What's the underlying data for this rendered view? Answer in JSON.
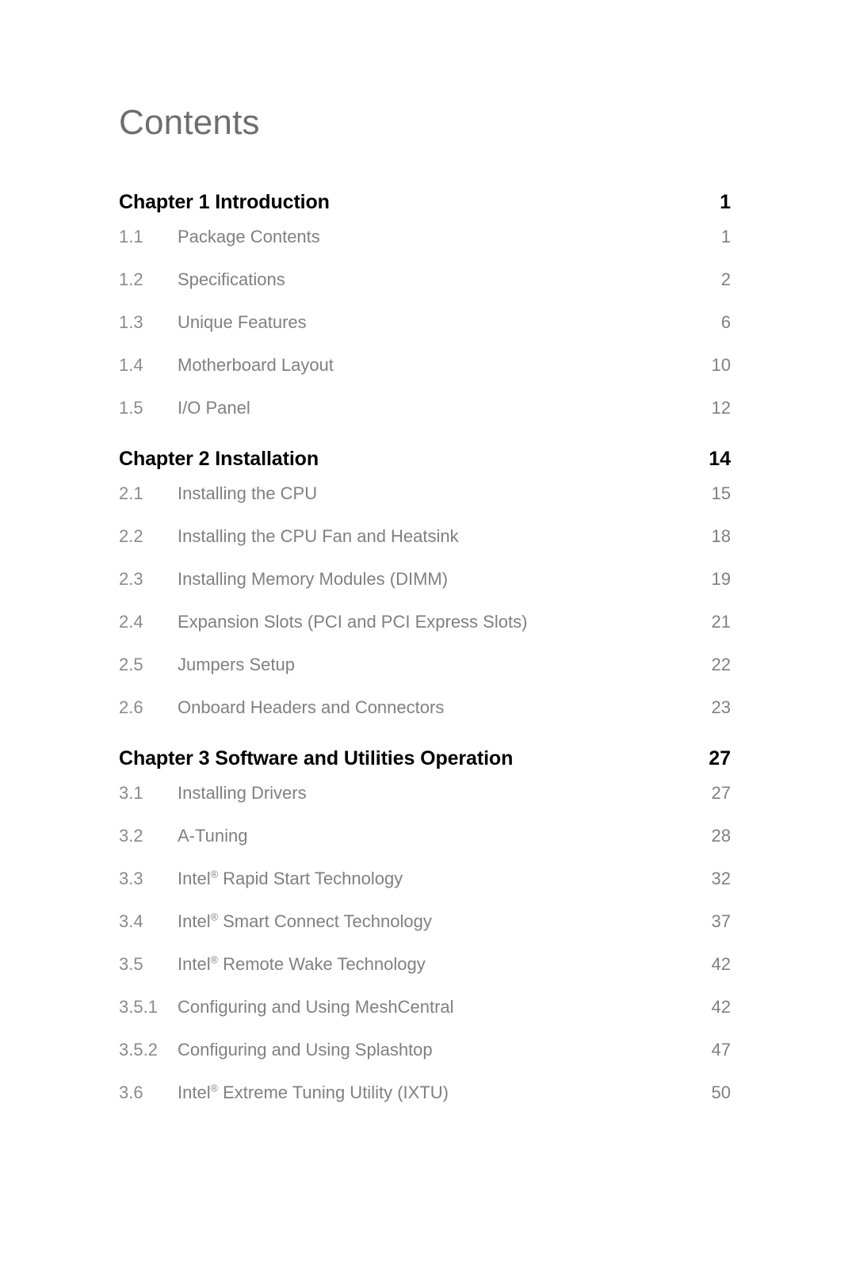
{
  "document": {
    "title": "Contents"
  },
  "colors": {
    "page_background": "#ffffff",
    "title_text": "#6e6e6e",
    "chapter_text": "#000000",
    "section_text": "#808080",
    "section_number_text": "#8a8a8a"
  },
  "toc": {
    "rows": [
      {
        "kind": "chapter",
        "number": "",
        "label": "Chapter  1  Introduction",
        "page": "1"
      },
      {
        "kind": "section",
        "number": "1.1",
        "label": "Package Contents",
        "page": "1"
      },
      {
        "kind": "section",
        "number": "1.2",
        "label": "Specifications",
        "page": "2"
      },
      {
        "kind": "section",
        "number": "1.3",
        "label": "Unique Features",
        "page": "6"
      },
      {
        "kind": "section",
        "number": "1.4",
        "label": "Motherboard Layout",
        "page": "10"
      },
      {
        "kind": "section",
        "number": "1.5",
        "label": "I/O Panel",
        "page": "12"
      },
      {
        "kind": "chapter",
        "number": "",
        "label": "Chapter  2  Installation",
        "page": "14"
      },
      {
        "kind": "section",
        "number": "2.1",
        "label": "Installing the CPU",
        "page": "15"
      },
      {
        "kind": "section",
        "number": "2.2",
        "label": "Installing the CPU Fan and Heatsink",
        "page": "18"
      },
      {
        "kind": "section",
        "number": "2.3",
        "label": "Installing Memory Modules (DIMM)",
        "page": "19"
      },
      {
        "kind": "section",
        "number": "2.4",
        "label": "Expansion Slots (PCI and PCI Express Slots)",
        "page": "21"
      },
      {
        "kind": "section",
        "number": "2.5",
        "label": "Jumpers Setup",
        "page": "22"
      },
      {
        "kind": "section",
        "number": "2.6",
        "label": "Onboard Headers and Connectors",
        "page": "23"
      },
      {
        "kind": "chapter",
        "number": "",
        "label": "Chapter  3  Software and Utilities Operation",
        "page": "27"
      },
      {
        "kind": "section",
        "number": "3.1",
        "label": "Installing Drivers",
        "page": "27"
      },
      {
        "kind": "section",
        "number": "3.2",
        "label": "A-Tuning",
        "page": "28"
      },
      {
        "kind": "section",
        "number": "3.3",
        "label": "Intel® Rapid Start Technology",
        "page": "32"
      },
      {
        "kind": "section",
        "number": "3.4",
        "label": "Intel® Smart Connect Technology",
        "page": "37"
      },
      {
        "kind": "section",
        "number": "3.5",
        "label": "Intel® Remote Wake Technology",
        "page": "42"
      },
      {
        "kind": "section",
        "number": "3.5.1",
        "label": "Configuring and Using MeshCentral",
        "page": "42"
      },
      {
        "kind": "section",
        "number": "3.5.2",
        "label": "Configuring and Using Splashtop",
        "page": "47"
      },
      {
        "kind": "section",
        "number": "3.6",
        "label": "Intel® Extreme Tuning Utility (IXTU)",
        "page": "50"
      }
    ]
  }
}
